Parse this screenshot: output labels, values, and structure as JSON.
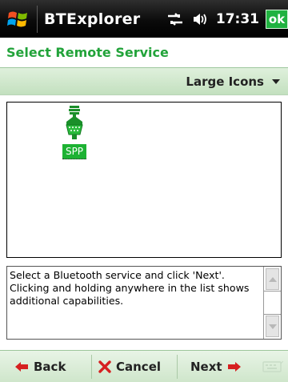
{
  "titlebar": {
    "app_title": "BTExplorer",
    "clock": "17:31",
    "ok_label": "ok",
    "icons": [
      "windows-start-icon",
      "connectivity-icon",
      "volume-icon"
    ]
  },
  "page": {
    "title": "Select Remote Service",
    "view_label": "Large Icons"
  },
  "services": [
    {
      "label": "SPP",
      "icon": "serial-port-icon",
      "selected": true
    }
  ],
  "description": "Select a Bluetooth service and click 'Next'. Clicking and holding anywhere in the list shows additional capabilities.",
  "softkeys": {
    "back": "Back",
    "cancel": "Cancel",
    "next": "Next"
  },
  "colors": {
    "accent_green": "#22a33a",
    "selection_green": "#1db233",
    "back_arrow_red": "#d62020"
  }
}
